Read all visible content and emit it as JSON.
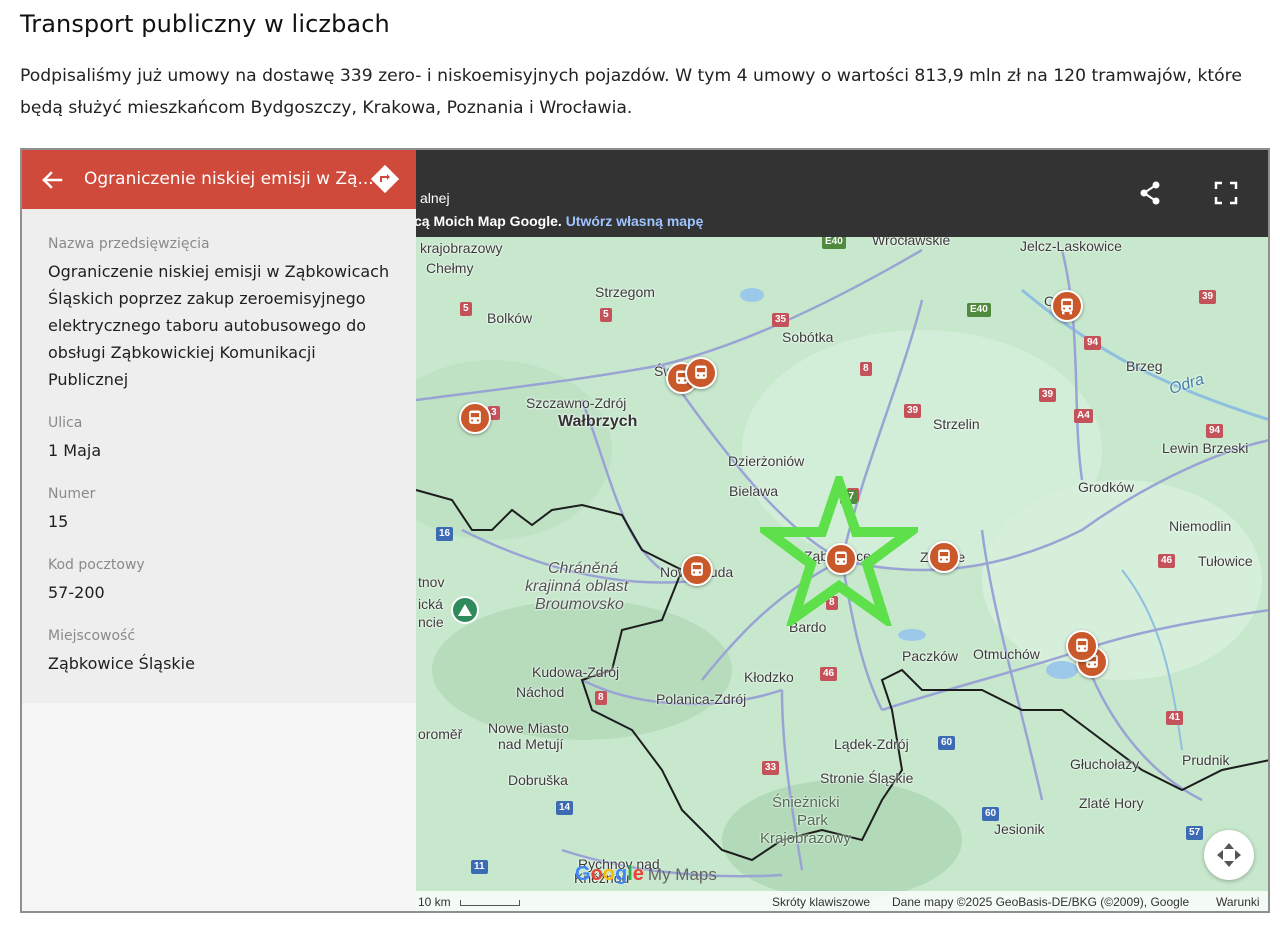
{
  "page": {
    "title": "Transport publiczny w liczbach",
    "intro": "Podpisaliśmy już umowy na dostawę 339 zero- i niskoemisyjnych pojazdów. W tym 4 umowy o wartości 813,9 mln zł na 120 tramwajów, które będą służyć mieszkańcom Bydgoszczy, Krakowa, Poznania i Wrocławia."
  },
  "map_header": {
    "subtitle_fragment": "alnej",
    "attribution_prefix": "cą Moich Map Google.",
    "attribution_link": "Utwórz własną mapę",
    "share_icon": "share-icon",
    "fullscreen_icon": "fullscreen-icon"
  },
  "panel": {
    "title": "Ograniczenie niskiej emisji w Zą...",
    "back_icon": "arrow-left-icon",
    "directions_icon": "directions-icon",
    "fields": [
      {
        "label": "Nazwa przedsięwzięcia",
        "value": "Ograniczenie niskiej emisji w Ząbkowicach Śląskich poprzez zakup zeroemisyjnego elektrycznego taboru autobusowego do obsługi Ząbkowickiej Komunikacji Publicznej"
      },
      {
        "label": "Ulica",
        "value": "1 Maja"
      },
      {
        "label": "Numer",
        "value": "15"
      },
      {
        "label": "Kod pocztowy",
        "value": "57-200"
      },
      {
        "label": "Miejscowość",
        "value": "Ząbkowice Śląskie"
      }
    ]
  },
  "map": {
    "places": [
      "krajobrazowy",
      "Chełmy",
      "Wrocławskie",
      "Jelcz-Laskowice",
      "Strzegom",
      "Bolków",
      "Sobótka",
      "Brzeg",
      "Odra",
      "Szczawno-Zdrój",
      "Wałbrzych",
      "Strzelin",
      "Lewin Brzeski",
      "Dzierżoniów",
      "Bielawa",
      "Grodków",
      "Niemodlin",
      "Tułowice",
      "Chráněná",
      "krajinná oblast",
      "Broumovsko",
      "Nowa Ruda",
      "Ząbkowice",
      "Ziębice",
      "Bardo",
      "tnov",
      "ická",
      "ncie",
      "Kudowa-Zdrój",
      "Náchod",
      "Polanica-Zdrój",
      "Kłodzko",
      "Paczków",
      "Otmuchów",
      "oroměř",
      "Nowe Miasto",
      "nad Metují",
      "Lądek-Zdrój",
      "Głuchołazy",
      "Prudnik",
      "Dobruška",
      "Stronie Śląskie",
      "Śnieżnicki",
      "Park",
      "Krajobrazowy",
      "Zlaté Hory",
      "Jesionik",
      "Rychnov nad",
      "Kněžnou",
      "Świdnica",
      "O"
    ],
    "roads": [
      "E40",
      "E40",
      "39",
      "5",
      "5",
      "35",
      "94",
      "8",
      "39",
      "39",
      "A4",
      "94",
      "3",
      "8",
      "16",
      "57",
      "46",
      "8",
      "46",
      "8",
      "41",
      "60",
      "33",
      "14",
      "60",
      "57",
      "11"
    ],
    "google_letters": [
      "G",
      "o",
      "o",
      "g",
      "l",
      "e"
    ],
    "google_colors": [
      "#4285F4",
      "#EA4335",
      "#FBBC05",
      "#4285F4",
      "#34A853",
      "#EA4335"
    ],
    "mymaps": "My Maps",
    "scale": "10 km",
    "shortcuts": "Skróty klawiszowe",
    "map_data": "Dane mapy ©2025 GeoBasis-DE/BKG (©2009), Google",
    "terms": "Warunki",
    "marker_icon": "bus-icon",
    "highlight_icon": "star-icon",
    "highlight_color": "#5ee04a",
    "marker_color": "#c9592b"
  }
}
